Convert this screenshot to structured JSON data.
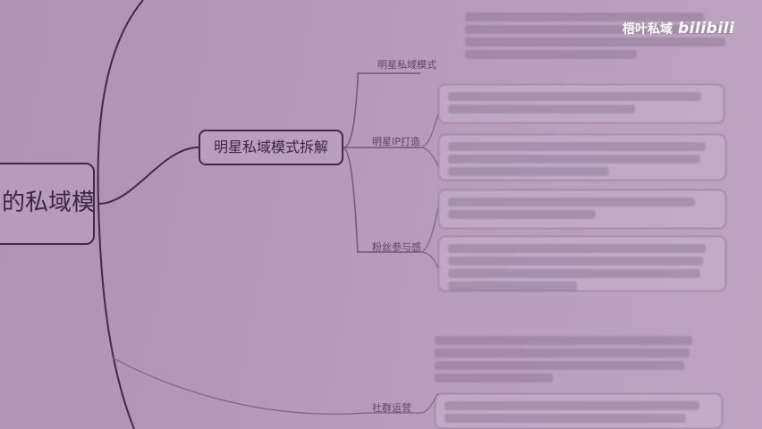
{
  "root": {
    "label": "的私域模"
  },
  "main_node": {
    "label": "明星私域模式拆解"
  },
  "branches": [
    {
      "label": "明星私域模式"
    },
    {
      "label": "明星IP打造"
    },
    {
      "label": "粉丝参与感"
    },
    {
      "label": "社群运营"
    }
  ],
  "watermark": {
    "text": "梧叶私域",
    "logo": "bilibili"
  },
  "colors": {
    "background": "#b398b6",
    "line": "#3f2b47",
    "watermark": "#ffffff"
  }
}
